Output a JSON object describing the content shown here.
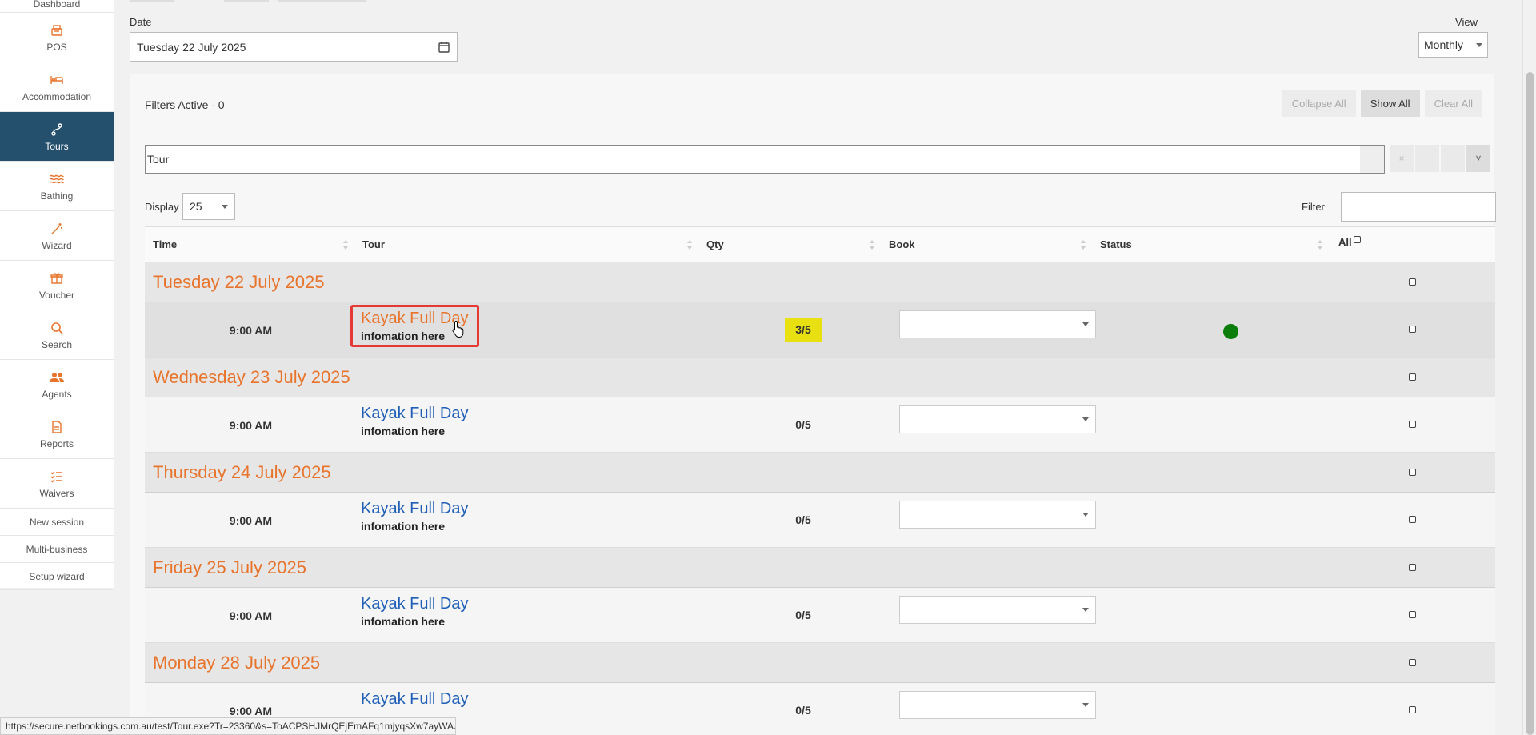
{
  "sidebar": {
    "partial_label": "Dashboard",
    "items": [
      {
        "label": "POS",
        "icon": "cash-register-icon"
      },
      {
        "label": "Accommodation",
        "icon": "bed-icon"
      },
      {
        "label": "Tours",
        "icon": "route-icon",
        "active": true
      },
      {
        "label": "Bathing",
        "icon": "water-icon"
      },
      {
        "label": "Wizard",
        "icon": "magic-wand-icon"
      },
      {
        "label": "Voucher",
        "icon": "gift-icon"
      },
      {
        "label": "Search",
        "icon": "search-icon"
      },
      {
        "label": "Agents",
        "icon": "users-icon"
      },
      {
        "label": "Reports",
        "icon": "report-icon"
      },
      {
        "label": "Waivers",
        "icon": "list-check-icon"
      }
    ],
    "text_links": [
      "New session",
      "Multi-business",
      "Setup wizard"
    ]
  },
  "toolbar": {
    "date_label": "Date",
    "date_value": "Tuesday 22 July 2025",
    "view_label": "View",
    "view_value": "Monthly"
  },
  "filters": {
    "active_text": "Filters Active - 0",
    "collapse_all": "Collapse All",
    "show_all": "Show All",
    "clear_all": "Clear All",
    "search_value": "Tour",
    "tool_clear": "×",
    "tool_dropdown": "˅",
    "display_label": "Display",
    "display_value": "25",
    "filter_label": "Filter"
  },
  "table": {
    "headers": {
      "time": "Time",
      "tour": "Tour",
      "qty": "Qty",
      "book": "Book",
      "status": "Status",
      "all": "All"
    },
    "groups": [
      {
        "date": "Tuesday 22 July 2025",
        "row": {
          "time": "9:00 AM",
          "tour": "Kayak Full Day",
          "info": "infomation here",
          "qty": "3/5"
        }
      },
      {
        "date": "Wednesday 23 July 2025",
        "row": {
          "time": "9:00 AM",
          "tour": "Kayak Full Day",
          "info": "infomation here",
          "qty": "0/5"
        }
      },
      {
        "date": "Thursday 24 July 2025",
        "row": {
          "time": "9:00 AM",
          "tour": "Kayak Full Day",
          "info": "infomation here",
          "qty": "0/5"
        }
      },
      {
        "date": "Friday 25 July 2025",
        "row": {
          "time": "9:00 AM",
          "tour": "Kayak Full Day",
          "info": "infomation here",
          "qty": "0/5"
        }
      },
      {
        "date": "Monday 28 July 2025",
        "row": {
          "time": "9:00 AM",
          "tour": "Kayak Full Day",
          "info": "",
          "qty": "0/5"
        }
      }
    ]
  },
  "status_bar": {
    "url": "https://secure.netbookings.com.au/test/Tour.exe?Tr=23360&s=ToACPSHJMrQEjEmAFq1mjyqsXw7ayWAJ"
  },
  "colors": {
    "accent_orange": "#e8742c",
    "nav_active": "#24506e",
    "link_blue": "#1f5fb8",
    "qty_highlight": "#e8e011",
    "status_green": "#0a7d0a",
    "selection_red": "#e53935"
  }
}
